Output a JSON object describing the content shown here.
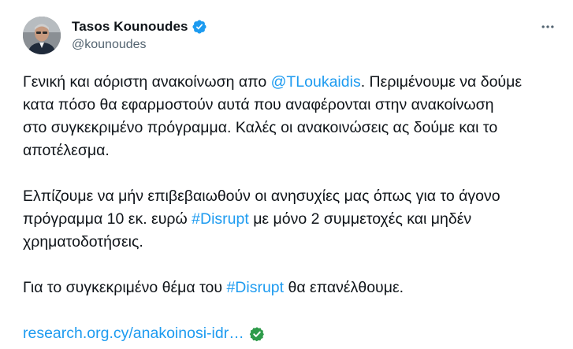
{
  "author": {
    "display_name": "Tasos Kounoudes",
    "handle": "@kounoudes",
    "verified": true
  },
  "more_icon": "more-dots-icon",
  "tweet": {
    "p1": {
      "l1_pre": "Γενική και αόριστη ανακοίνωση απο ",
      "l1_mention": "@TLoukaidis",
      "l1_post": ". Περιμένουμε να δούμε",
      "l2": "κατα πόσο θα εφαρμοστούν αυτά που αναφέρονται στην ανακοίνωση",
      "l3": "στο συγκεκριμένο πρόγραμμα. Καλές οι ανακοινώσεις ας δούμε και το",
      "l4": "αποτέλεσμα."
    },
    "p2": {
      "l1": "Ελπίζουμε να μήν επιβεβαιωθούν οι ανησυχίες μας όπως για το άγονο",
      "l2_pre": "πρόγραμμα 10 εκ. ευρώ ",
      "l2_hashtag": "#Disrupt",
      "l2_post": " με μόνο 2 συμμετοχές και μηδέν",
      "l3": "χρηματοδοτήσεις."
    },
    "p3": {
      "pre": "Για το συγκεκριμένο θέμα του ",
      "hashtag": "#Disrupt",
      "post": " θα επανέλθουμε."
    },
    "link": {
      "text": "research.org.cy/anakoinosi-idr…",
      "icon": "check-circle-icon"
    }
  },
  "colors": {
    "link": "#1d9bf0",
    "text": "#0f1419",
    "secondary": "#536471",
    "verified": "#1d9bf0",
    "check": "#2e9b4a"
  }
}
